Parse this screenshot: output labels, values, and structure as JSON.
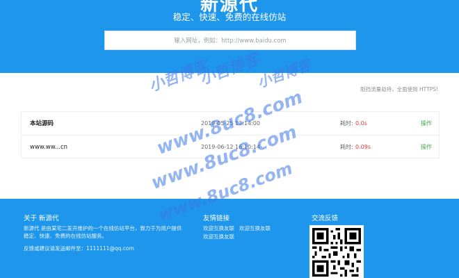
{
  "hero": {
    "title": "新源代",
    "subtitle": "稳定、快速、免费的在线仿站",
    "search_placeholder": "输入网址，例如：http://www.baidu.com"
  },
  "notice": "阻挡流量劫持，全面使用 HTTPS!",
  "records": [
    {
      "name": "本站源码",
      "date": "2019-05-25 13:14:00",
      "time_label": "耗时:",
      "time": "0.0s",
      "action": "操作"
    },
    {
      "name": "www.ww...cn",
      "date": "2019-06-12 16:10:14",
      "time_label": "耗时:",
      "time": "0.09s",
      "action": "操作"
    }
  ],
  "footer": {
    "about": {
      "heading": "关于 新源代",
      "line1": "新源代 是由某宅二发开维护的一个在线仿站平台，致力于为用户提供",
      "line2": "稳定、快速、免费的在线仿站服务。",
      "contact": "反馈或建议请发送邮件至：1111111@qq.com"
    },
    "links": {
      "heading": "友情链接",
      "items": [
        "欢迎互换友联",
        "欢迎互换友联",
        "欢迎互换友联"
      ]
    },
    "feedback": {
      "heading": "交流反馈"
    }
  },
  "watermark": {
    "text1": "小哲博客",
    "text2": "小哲博客",
    "text3": "www.8uc8.com",
    "text4": "小哲博客",
    "text5": "www.8uc8.com",
    "text6": "www.8uc8.com"
  },
  "colors": {
    "brand_blue": "#1e96eb",
    "time_red": "#e33b3b",
    "action_green": "#3fa64b"
  }
}
